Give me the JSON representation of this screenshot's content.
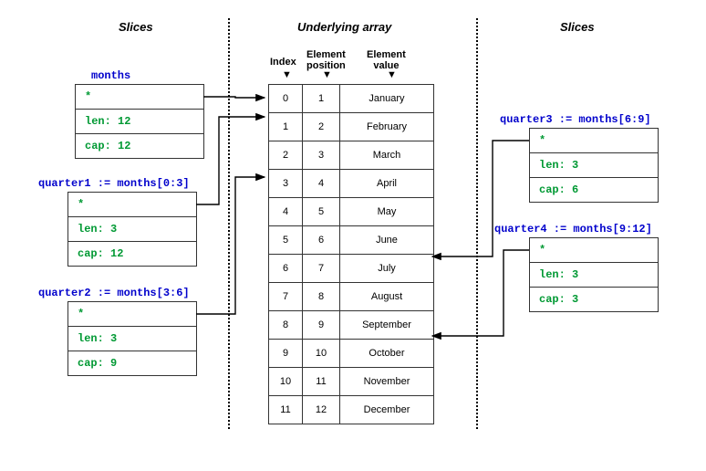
{
  "titles": {
    "left": "Slices",
    "center": "Underlying array",
    "right": "Slices"
  },
  "col_headers": {
    "index": "Index",
    "position": "Element\nposition",
    "value": "Element\nvalue"
  },
  "array": [
    {
      "idx": "0",
      "pos": "1",
      "val": "January"
    },
    {
      "idx": "1",
      "pos": "2",
      "val": "February"
    },
    {
      "idx": "2",
      "pos": "3",
      "val": "March"
    },
    {
      "idx": "3",
      "pos": "4",
      "val": "April"
    },
    {
      "idx": "4",
      "pos": "5",
      "val": "May"
    },
    {
      "idx": "5",
      "pos": "6",
      "val": "June"
    },
    {
      "idx": "6",
      "pos": "7",
      "val": "July"
    },
    {
      "idx": "7",
      "pos": "8",
      "val": "August"
    },
    {
      "idx": "8",
      "pos": "9",
      "val": "September"
    },
    {
      "idx": "9",
      "pos": "10",
      "val": "October"
    },
    {
      "idx": "10",
      "pos": "11",
      "val": "November"
    },
    {
      "idx": "11",
      "pos": "12",
      "val": "December"
    }
  ],
  "slices": {
    "months": {
      "label": "months",
      "ptr": "*",
      "len": "len: 12",
      "cap": "cap: 12"
    },
    "quarter1": {
      "label": "quarter1 := months[0:3]",
      "ptr": "*",
      "len": "len: 3",
      "cap": "cap: 12"
    },
    "quarter2": {
      "label": "quarter2 := months[3:6]",
      "ptr": "*",
      "len": "len: 3",
      "cap": "cap: 9"
    },
    "quarter3": {
      "label": "quarter3 := months[6:9]",
      "ptr": "*",
      "len": "len: 3",
      "cap": "cap: 6"
    },
    "quarter4": {
      "label": "quarter4 := months[9:12]",
      "ptr": "*",
      "len": "len: 3",
      "cap": "cap: 3"
    }
  }
}
